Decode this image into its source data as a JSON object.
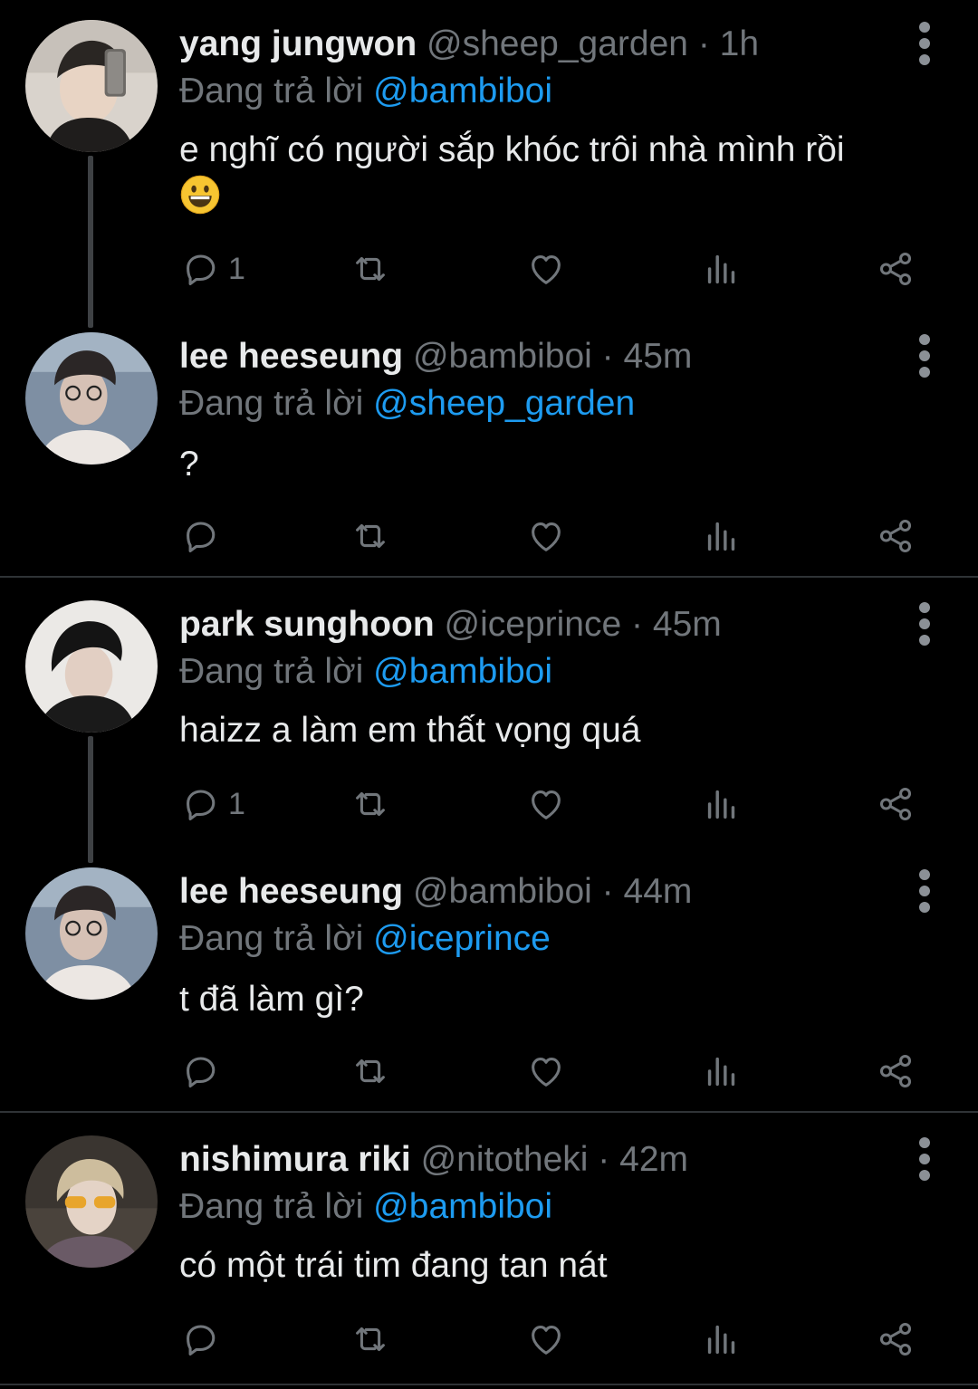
{
  "colors": {
    "background": "#000000",
    "text": "#e7e9ea",
    "muted": "#71767b",
    "accent": "#1d9bf0",
    "divider": "#2f3336"
  },
  "tweets": [
    {
      "name": "yang jungwon",
      "handle": "@sheep_garden",
      "time": "1h",
      "reply_prefix": "Đang trả lời",
      "reply_to": "@bambiboi",
      "text": "e nghĩ có người sắp khóc trôi nhà mình rồi",
      "emoji": "grinning-face-emoji",
      "reply_count": "1"
    },
    {
      "name": "lee heeseung",
      "handle": "@bambiboi",
      "time": "45m",
      "reply_prefix": "Đang trả lời",
      "reply_to": "@sheep_garden",
      "text": "?",
      "reply_count": ""
    },
    {
      "name": "park sunghoon",
      "handle": "@iceprince",
      "time": "45m",
      "reply_prefix": "Đang trả lời",
      "reply_to": "@bambiboi",
      "text": "haizz a làm em thất vọng quá",
      "reply_count": "1"
    },
    {
      "name": "lee heeseung",
      "handle": "@bambiboi",
      "time": "44m",
      "reply_prefix": "Đang trả lời",
      "reply_to": "@iceprince",
      "text": "t đã làm gì?",
      "reply_count": ""
    },
    {
      "name": "nishimura riki",
      "handle": "@nitotheki",
      "time": "42m",
      "reply_prefix": "Đang trả lời",
      "reply_to": "@bambiboi",
      "text": "có một trái tim đang tan nát",
      "reply_count": ""
    }
  ],
  "separator": "·",
  "action_icons": [
    "reply-icon",
    "retweet-icon",
    "like-icon",
    "views-icon",
    "share-icon"
  ]
}
